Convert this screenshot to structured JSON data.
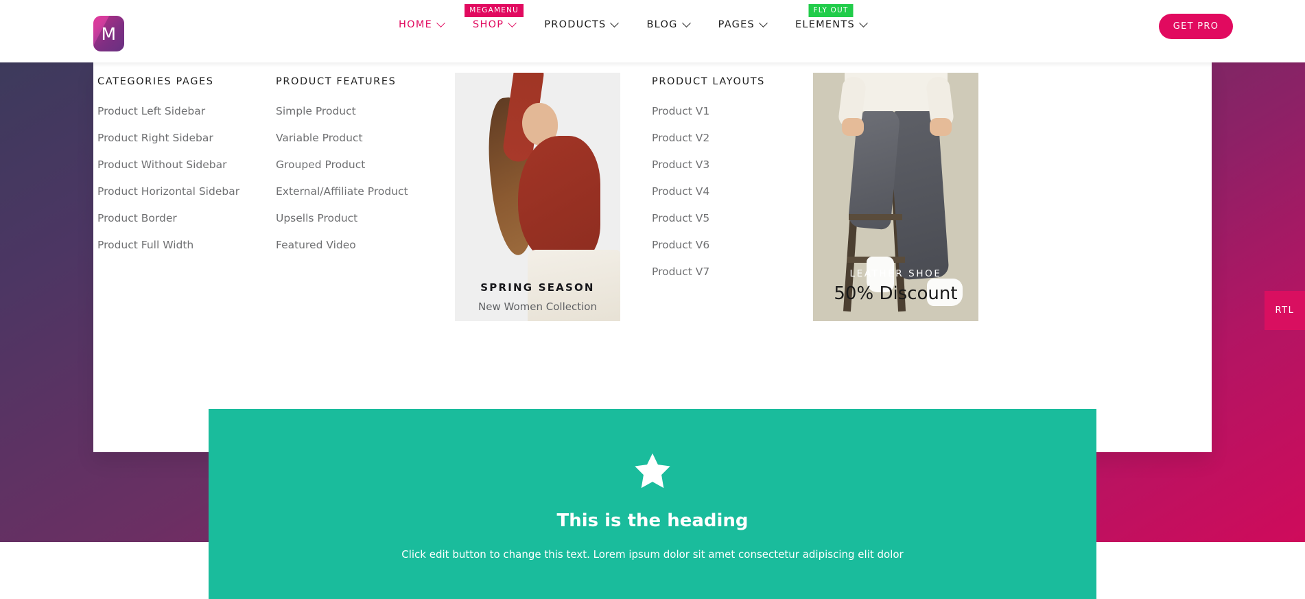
{
  "header": {
    "logo_letter": "M",
    "nav": [
      {
        "label": "HOME",
        "accent": true,
        "has_caret": true,
        "badge": null,
        "badge_style": null
      },
      {
        "label": "SHOP",
        "accent": true,
        "has_caret": true,
        "badge": "MEGAMENU",
        "badge_style": "pink"
      },
      {
        "label": "PRODUCTS",
        "accent": false,
        "has_caret": true,
        "badge": null,
        "badge_style": null
      },
      {
        "label": "BLOG",
        "accent": false,
        "has_caret": true,
        "badge": null,
        "badge_style": null
      },
      {
        "label": "PAGES",
        "accent": false,
        "has_caret": true,
        "badge": null,
        "badge_style": null
      },
      {
        "label": "ELEMENTS",
        "accent": false,
        "has_caret": true,
        "badge": "FLY OUT",
        "badge_style": "green"
      }
    ],
    "cta_label": "GET PRO"
  },
  "megamenu": {
    "columns": [
      {
        "title": "CATEGORIES PAGES",
        "items": [
          "Product Left Sidebar",
          "Product Right Sidebar",
          "Product Without Sidebar",
          "Product Horizontal Sidebar",
          "Product Border",
          "Product Full Width"
        ]
      },
      {
        "title": "PRODUCT FEATURES",
        "items": [
          "Simple Product",
          "Variable Product",
          "Grouped Product",
          "External/Affiliate Product",
          "Upsells Product",
          "Featured Video"
        ]
      },
      {
        "title": "PRODUCT LAYOUTS",
        "items": [
          "Product V1",
          "Product V2",
          "Product V3",
          "Product V4",
          "Product V5",
          "Product V6",
          "Product V7"
        ]
      }
    ],
    "promos": [
      {
        "kicker": "SPRING SEASON",
        "subtitle": "New Women Collection",
        "image_alt": "woman-in-red-top-banner"
      },
      {
        "kicker": "LEATHER SHOE",
        "subtitle": "50% Discount",
        "image_alt": "man-on-stool-jeans-banner"
      }
    ]
  },
  "feature_box": {
    "icon": "star-icon",
    "heading": "This is the heading",
    "body": "Click edit button to change this text. Lorem ipsum dolor sit amet consectetur adipiscing elit dolor"
  },
  "side_tab": {
    "label": "RTL"
  },
  "colors": {
    "accent_pink": "#e10a5f",
    "badge_green": "#21cc4a",
    "teal": "#1abc9c",
    "rtl_tab": "#d90f60",
    "promo_shoe_bg": "#cfcab8",
    "promo_spring_bg": "#efefef"
  }
}
